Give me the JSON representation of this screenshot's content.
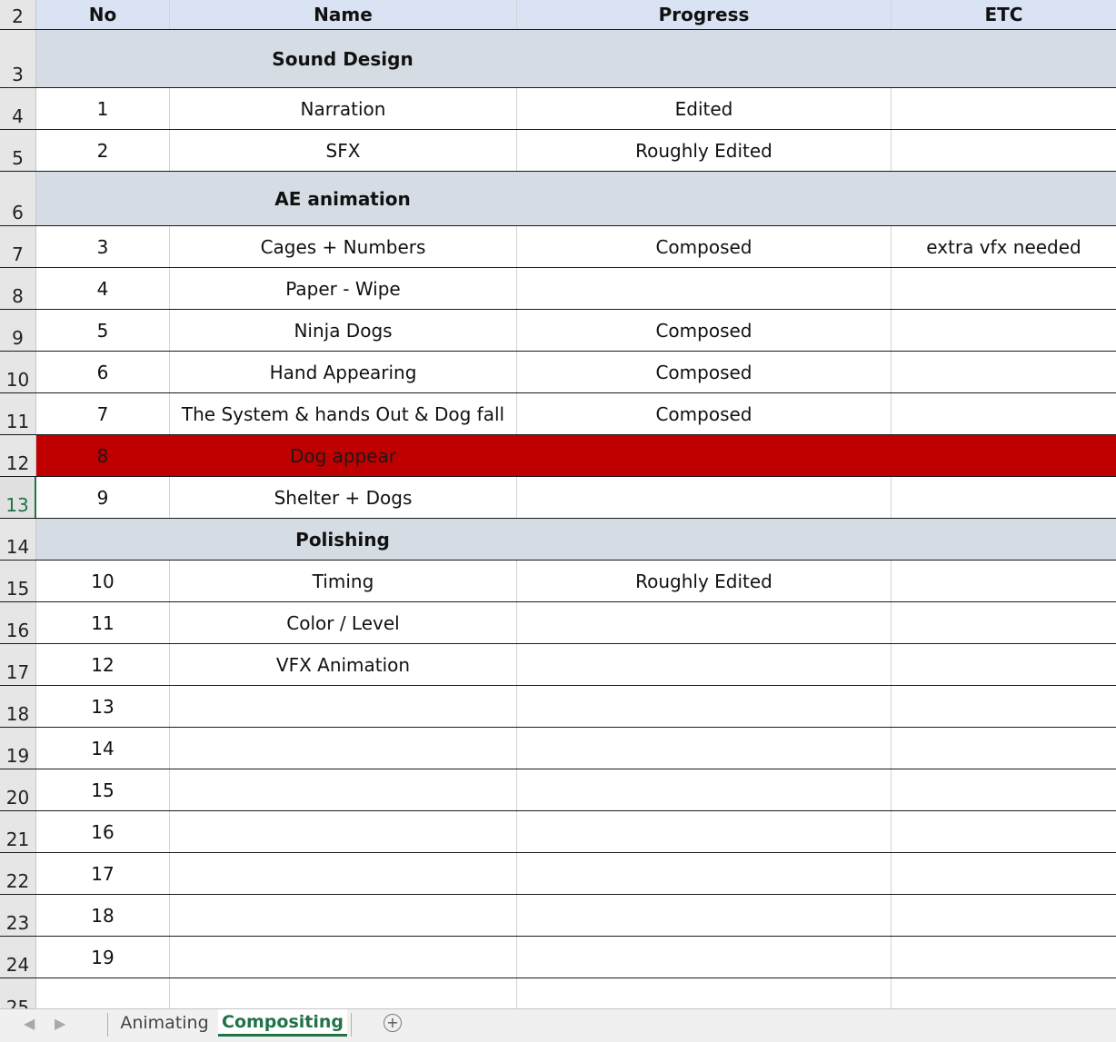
{
  "columns": {
    "no": "No",
    "name": "Name",
    "progress": "Progress",
    "etc": "ETC"
  },
  "rows": [
    {
      "rownum": "2",
      "type": "header"
    },
    {
      "rownum": "3",
      "type": "section",
      "title": "Sound Design"
    },
    {
      "rownum": "4",
      "type": "item",
      "no": "1",
      "name": "Narration",
      "progress": "Edited",
      "etc": ""
    },
    {
      "rownum": "5",
      "type": "item",
      "no": "2",
      "name": "SFX",
      "progress": "Roughly Edited",
      "etc": ""
    },
    {
      "rownum": "6",
      "type": "section",
      "title": "AE animation"
    },
    {
      "rownum": "7",
      "type": "item",
      "no": "3",
      "name": "Cages + Numbers",
      "progress": "Composed",
      "etc": "extra vfx needed"
    },
    {
      "rownum": "8",
      "type": "item",
      "no": "4",
      "name": "Paper - Wipe",
      "progress": "",
      "etc": ""
    },
    {
      "rownum": "9",
      "type": "item",
      "no": "5",
      "name": "Ninja Dogs",
      "progress": "Composed",
      "etc": ""
    },
    {
      "rownum": "10",
      "type": "item",
      "no": "6",
      "name": "Hand Appearing",
      "progress": "Composed",
      "etc": ""
    },
    {
      "rownum": "11",
      "type": "item",
      "no": "7",
      "name": "The System & hands Out & Dog fall",
      "progress": "Composed",
      "etc": ""
    },
    {
      "rownum": "12",
      "type": "item",
      "no": "8",
      "name": "Dog appear",
      "progress": "",
      "etc": "",
      "highlight": "#c00000"
    },
    {
      "rownum": "13",
      "type": "item",
      "no": "9",
      "name": "Shelter + Dogs",
      "progress": "",
      "etc": "",
      "selected": true
    },
    {
      "rownum": "14",
      "type": "section",
      "title": "Polishing"
    },
    {
      "rownum": "15",
      "type": "item",
      "no": "10",
      "name": "Timing",
      "progress": "Roughly Edited",
      "etc": ""
    },
    {
      "rownum": "16",
      "type": "item",
      "no": "11",
      "name": "Color / Level",
      "progress": "",
      "etc": ""
    },
    {
      "rownum": "17",
      "type": "item",
      "no": "12",
      "name": "VFX Animation",
      "progress": "",
      "etc": ""
    },
    {
      "rownum": "18",
      "type": "item",
      "no": "13",
      "name": "",
      "progress": "",
      "etc": ""
    },
    {
      "rownum": "19",
      "type": "item",
      "no": "14",
      "name": "",
      "progress": "",
      "etc": ""
    },
    {
      "rownum": "20",
      "type": "item",
      "no": "15",
      "name": "",
      "progress": "",
      "etc": ""
    },
    {
      "rownum": "21",
      "type": "item",
      "no": "16",
      "name": "",
      "progress": "",
      "etc": ""
    },
    {
      "rownum": "22",
      "type": "item",
      "no": "17",
      "name": "",
      "progress": "",
      "etc": ""
    },
    {
      "rownum": "23",
      "type": "item",
      "no": "18",
      "name": "",
      "progress": "",
      "etc": ""
    },
    {
      "rownum": "24",
      "type": "item",
      "no": "19",
      "name": "",
      "progress": "",
      "etc": ""
    },
    {
      "rownum": "25",
      "type": "blank"
    }
  ],
  "sheet_tabs": [
    {
      "label": "Animating",
      "active": false
    },
    {
      "label": "Compositing",
      "active": true
    }
  ],
  "icons": {
    "prev": "chevron-left-icon",
    "next": "chevron-right-icon",
    "add": "plus-circle-icon"
  },
  "colors": {
    "header_fill": "#dae3f3",
    "section_fill": "#d6dce4",
    "highlight_fill": "#c00000",
    "accent": "#217346"
  }
}
